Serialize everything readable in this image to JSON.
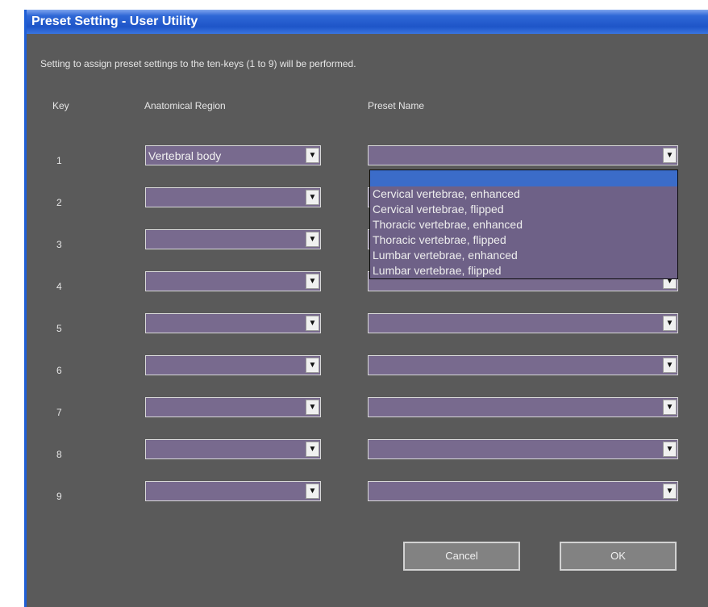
{
  "window": {
    "title": "Preset Setting - User Utility"
  },
  "description": "Setting to assign preset settings to the ten-keys (1 to 9) will be performed.",
  "headers": {
    "key": "Key",
    "region": "Anatomical Region",
    "preset": "Preset Name"
  },
  "rows": [
    {
      "key": "1",
      "region": "Vertebral body",
      "preset": ""
    },
    {
      "key": "2",
      "region": "",
      "preset": ""
    },
    {
      "key": "3",
      "region": "",
      "preset": ""
    },
    {
      "key": "4",
      "region": "",
      "preset": ""
    },
    {
      "key": "5",
      "region": "",
      "preset": ""
    },
    {
      "key": "6",
      "region": "",
      "preset": ""
    },
    {
      "key": "7",
      "region": "",
      "preset": ""
    },
    {
      "key": "8",
      "region": "",
      "preset": ""
    },
    {
      "key": "9",
      "region": "",
      "preset": ""
    }
  ],
  "dropdown": {
    "options": [
      "",
      "Cervical vertebrae, enhanced",
      "Cervical vertebrae, flipped",
      "Thoracic vertebrae, enhanced",
      "Thoracic vertebrae, flipped",
      "Lumbar vertebrae, enhanced",
      "Lumbar vertebrae, flipped"
    ]
  },
  "buttons": {
    "cancel": "Cancel",
    "ok": "OK"
  },
  "icons": {
    "combo_arrow": "chevron-down-icon"
  },
  "colors": {
    "window_bg": "#5a5a5a",
    "field_bg": "#786a8e",
    "titlebar": "#1e55c8",
    "highlight": "#3b6cc9"
  }
}
